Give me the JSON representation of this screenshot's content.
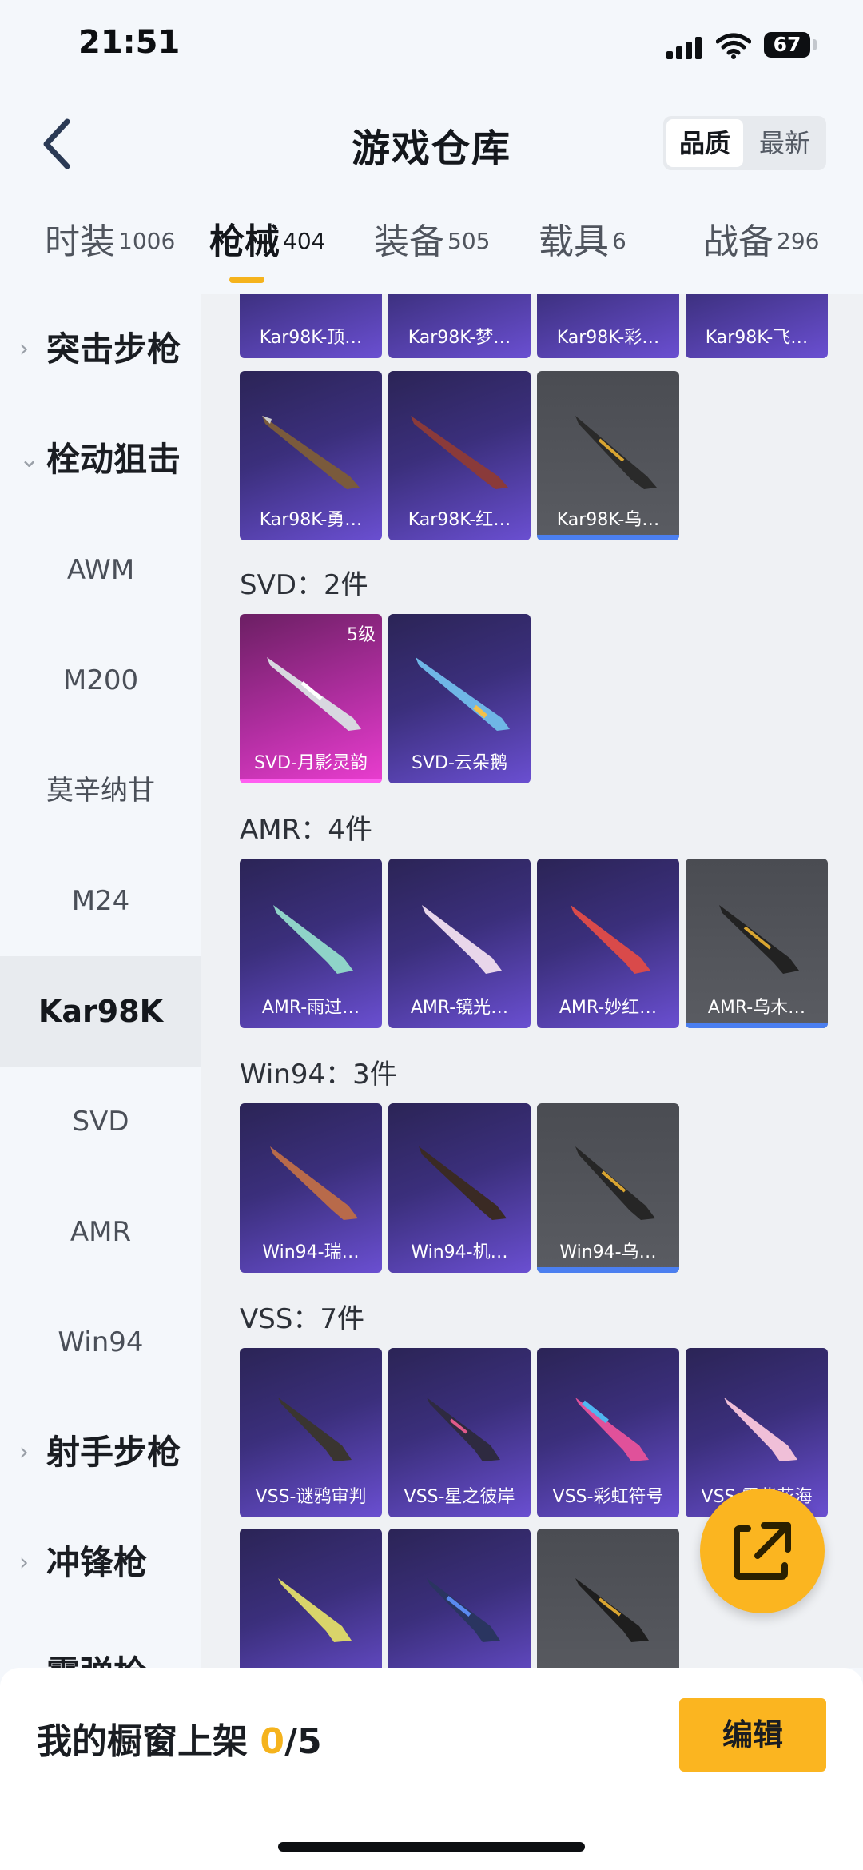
{
  "status": {
    "time": "21:51",
    "battery": "67"
  },
  "header": {
    "title": "游戏仓库",
    "sort_options": [
      "品质",
      "最新"
    ],
    "active_sort": "品质"
  },
  "tabs": [
    {
      "label": "时装",
      "count": "1006"
    },
    {
      "label": "枪械",
      "count": "404",
      "active": true
    },
    {
      "label": "装备",
      "count": "505"
    },
    {
      "label": "载具",
      "count": "6"
    },
    {
      "label": "战备",
      "count": "296"
    }
  ],
  "sidebar": {
    "items": [
      {
        "label": "突击步枪",
        "type": "group",
        "expanded": false
      },
      {
        "label": "栓动狙击",
        "type": "group",
        "expanded": true
      },
      {
        "label": "AWM",
        "type": "sub"
      },
      {
        "label": "M200",
        "type": "sub"
      },
      {
        "label": "莫辛纳甘",
        "type": "sub"
      },
      {
        "label": "M24",
        "type": "sub"
      },
      {
        "label": "Kar98K",
        "type": "sub",
        "active": true
      },
      {
        "label": "SVD",
        "type": "sub"
      },
      {
        "label": "AMR",
        "type": "sub"
      },
      {
        "label": "Win94",
        "type": "sub"
      },
      {
        "label": "射手步枪",
        "type": "group",
        "expanded": false
      },
      {
        "label": "冲锋枪",
        "type": "group",
        "expanded": false
      },
      {
        "label": "霰弹枪",
        "type": "group",
        "expanded": false
      }
    ]
  },
  "sections": [
    {
      "title": "",
      "items": [
        {
          "name": "Kar98K-顶…",
          "style": "purple"
        },
        {
          "name": "Kar98K-梦…",
          "style": "purple"
        },
        {
          "name": "Kar98K-彩…",
          "style": "purple"
        },
        {
          "name": "Kar98K-飞…",
          "style": "purple"
        },
        {
          "name": "Kar98K-勇…",
          "style": "purple"
        },
        {
          "name": "Kar98K-红…",
          "style": "purple"
        },
        {
          "name": "Kar98K-乌…",
          "style": "gray"
        }
      ]
    },
    {
      "title": "SVD：2件",
      "items": [
        {
          "name": "SVD-月影灵韵",
          "style": "pink",
          "level": "5级"
        },
        {
          "name": "SVD-云朵鹅",
          "style": "purple"
        }
      ]
    },
    {
      "title": "AMR：4件",
      "items": [
        {
          "name": "AMR-雨过…",
          "style": "purple"
        },
        {
          "name": "AMR-镜光…",
          "style": "purple"
        },
        {
          "name": "AMR-妙红…",
          "style": "purple"
        },
        {
          "name": "AMR-乌木…",
          "style": "gray"
        }
      ]
    },
    {
      "title": "Win94：3件",
      "items": [
        {
          "name": "Win94-瑞…",
          "style": "purple"
        },
        {
          "name": "Win94-机…",
          "style": "purple"
        },
        {
          "name": "Win94-乌…",
          "style": "gray"
        }
      ]
    },
    {
      "title": "VSS：7件",
      "items": [
        {
          "name": "VSS-谜鸦审判",
          "style": "purple"
        },
        {
          "name": "VSS-星之彼岸",
          "style": "purple"
        },
        {
          "name": "VSS-彩虹符号",
          "style": "purple"
        },
        {
          "name": "VSS-霞紫花海",
          "style": "purple"
        },
        {
          "name": "",
          "style": "purple"
        },
        {
          "name": "",
          "style": "purple"
        },
        {
          "name": "",
          "style": "gray"
        }
      ]
    }
  ],
  "bottom": {
    "showcase_label": "我的橱窗上架",
    "current": "0",
    "total": "/5",
    "edit": "编辑"
  },
  "colors": {
    "accent": "#fbb520",
    "card_purple": "#3b2f7c",
    "card_gray": "#4a4c52",
    "card_pink": "#b02ea0"
  }
}
